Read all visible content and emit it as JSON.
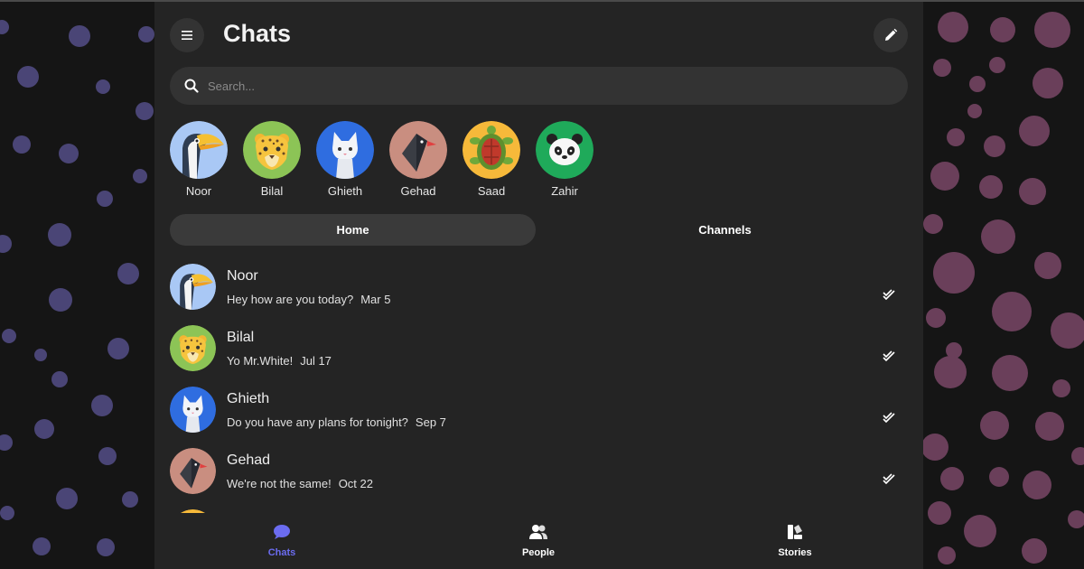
{
  "app": {
    "title": "Chats"
  },
  "search": {
    "placeholder": "Search..."
  },
  "stories": [
    {
      "name": "Noor",
      "avatar": "toucan-avatar"
    },
    {
      "name": "Bilal",
      "avatar": "leopard-avatar"
    },
    {
      "name": "Ghieth",
      "avatar": "white-cat-avatar"
    },
    {
      "name": "Gehad",
      "avatar": "bird-avatar"
    },
    {
      "name": "Saad",
      "avatar": "turtle-avatar"
    },
    {
      "name": "Zahir",
      "avatar": "panda-avatar"
    }
  ],
  "tabs": [
    {
      "label": "Home",
      "active": true
    },
    {
      "label": "Channels",
      "active": false
    }
  ],
  "chats": [
    {
      "name": "Noor",
      "message": "Hey how are you today?",
      "date": "Mar 5",
      "status": "double-check-icon"
    },
    {
      "name": "Bilal",
      "message": "Yo Mr.White!",
      "date": "Jul 17",
      "status": "double-check-icon"
    },
    {
      "name": "Ghieth",
      "message": "Do you have any plans for tonight?",
      "date": "Sep 7",
      "status": "double-check-icon"
    },
    {
      "name": "Gehad",
      "message": "We're not the same!",
      "date": "Oct 22",
      "status": "double-check-icon"
    }
  ],
  "nav": [
    {
      "label": "Chats",
      "icon": "chat-bubble-icon",
      "active": true
    },
    {
      "label": "People",
      "icon": "people-icon",
      "active": false
    },
    {
      "label": "Stories",
      "icon": "stories-icon",
      "active": false
    }
  ],
  "colors": {
    "background": "#151515",
    "panel": "#242424",
    "surface": "#333333",
    "accent": "#6b6cf0",
    "text": "#ffffff"
  }
}
